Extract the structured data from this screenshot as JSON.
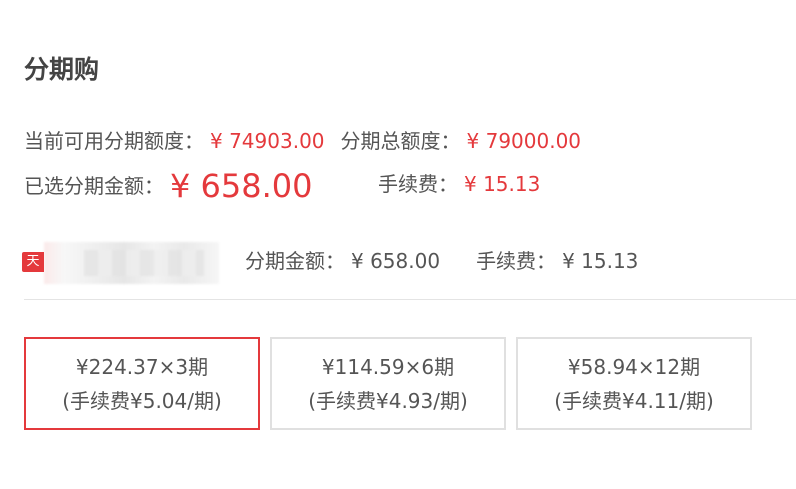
{
  "title": "分期购",
  "summary": {
    "available_label": "当前可用分期额度：",
    "available_value": "¥ 74903.00",
    "total_label": "分期总额度：",
    "total_value": "¥ 79000.00",
    "selected_label": "已选分期金额：",
    "selected_value": "¥ 658.00",
    "fee_label": "手续费：",
    "fee_value": "¥ 15.13"
  },
  "product": {
    "badge": "天",
    "amount_label": "分期金额：",
    "amount_value": "¥ 658.00",
    "fee_label": "手续费：",
    "fee_value": "¥ 15.13"
  },
  "plans": [
    {
      "line1": "¥224.37×3期",
      "line2": "(手续费¥5.04/期)",
      "selected": true
    },
    {
      "line1": "¥114.59×6期",
      "line2": "(手续费¥4.93/期)",
      "selected": false
    },
    {
      "line1": "¥58.94×12期",
      "line2": "(手续费¥4.11/期)",
      "selected": false
    }
  ],
  "colors": {
    "accent": "#e4393c",
    "border": "#e0e0e0",
    "text": "#555555"
  }
}
